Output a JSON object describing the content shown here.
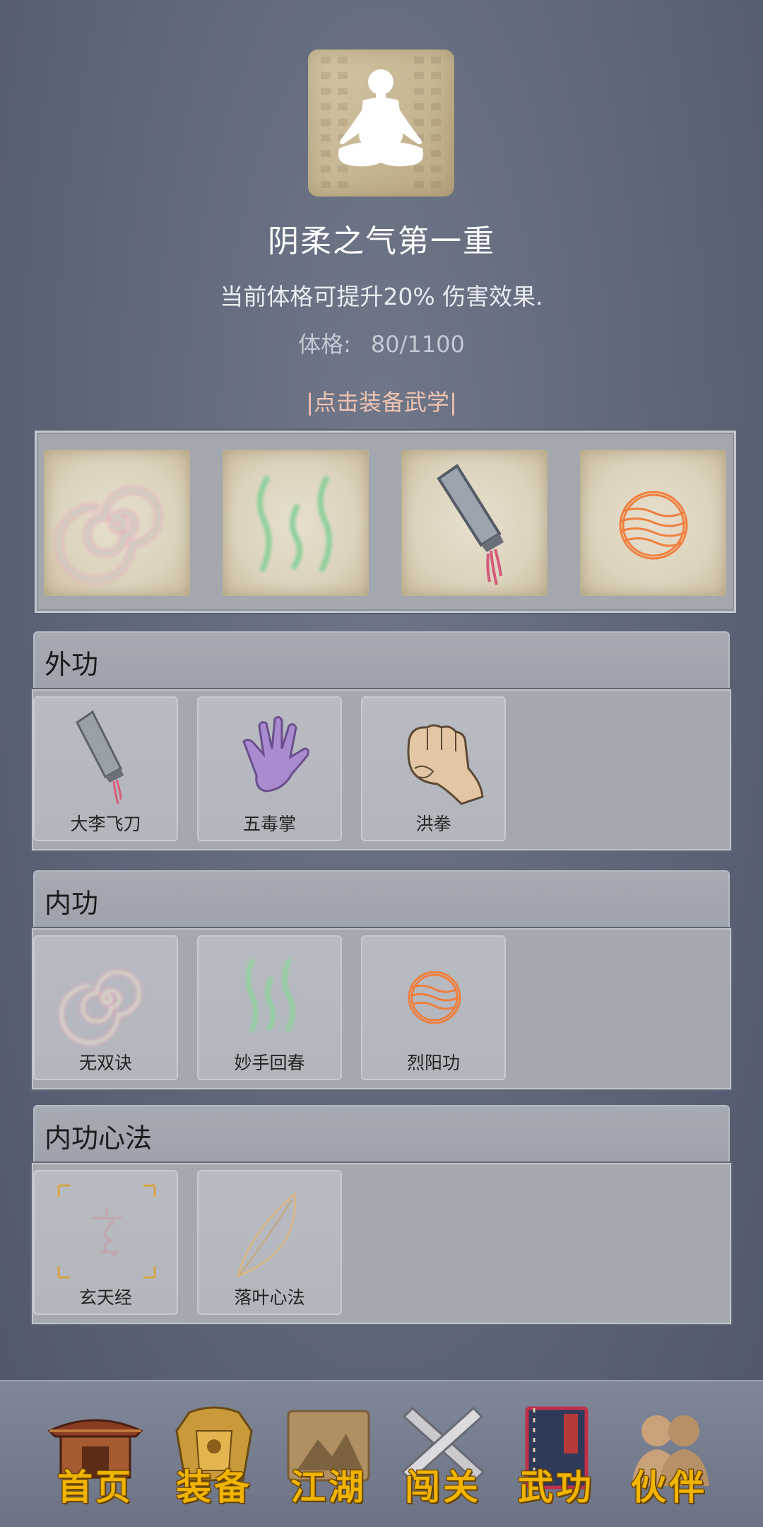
{
  "header": {
    "skill_title": "阴柔之气第一重",
    "description": "当前体格可提升20% 伤害效果.",
    "stat_label": "体格:",
    "stat_value": "80/1100",
    "equip_hint": "|点击装备武学|"
  },
  "equipped_slots": [
    {
      "icon": "spiral-icon"
    },
    {
      "icon": "green-waves-icon"
    },
    {
      "icon": "cleaver-icon"
    },
    {
      "icon": "fire-orb-icon"
    }
  ],
  "categories": [
    {
      "title": "外功",
      "skills": [
        {
          "name": "大李飞刀",
          "icon": "cleaver-icon"
        },
        {
          "name": "五毒掌",
          "icon": "purple-hand-icon"
        },
        {
          "name": "洪拳",
          "icon": "fist-icon"
        }
      ]
    },
    {
      "title": "内功",
      "skills": [
        {
          "name": "无双诀",
          "icon": "spiral-icon"
        },
        {
          "name": "妙手回春",
          "icon": "green-waves-icon"
        },
        {
          "name": "烈阳功",
          "icon": "fire-orb-icon"
        }
      ]
    },
    {
      "title": "内功心法",
      "skills": [
        {
          "name": "玄天经",
          "icon": "xuan-scroll-icon"
        },
        {
          "name": "落叶心法",
          "icon": "leaf-icon"
        }
      ]
    }
  ],
  "nav": [
    {
      "label": "首页",
      "icon": "house-icon"
    },
    {
      "label": "装备",
      "icon": "armor-icon"
    },
    {
      "label": "江湖",
      "icon": "map-scroll-icon"
    },
    {
      "label": "闯关",
      "icon": "crossed-swords-icon"
    },
    {
      "label": "武功",
      "icon": "book-icon",
      "active": true
    },
    {
      "label": "伙伴",
      "icon": "companions-icon"
    }
  ],
  "colors": {
    "background": "#5d6578",
    "hint": "#f0c3b1",
    "nav_label": "#f0b400",
    "active_border": "#c0304a"
  }
}
